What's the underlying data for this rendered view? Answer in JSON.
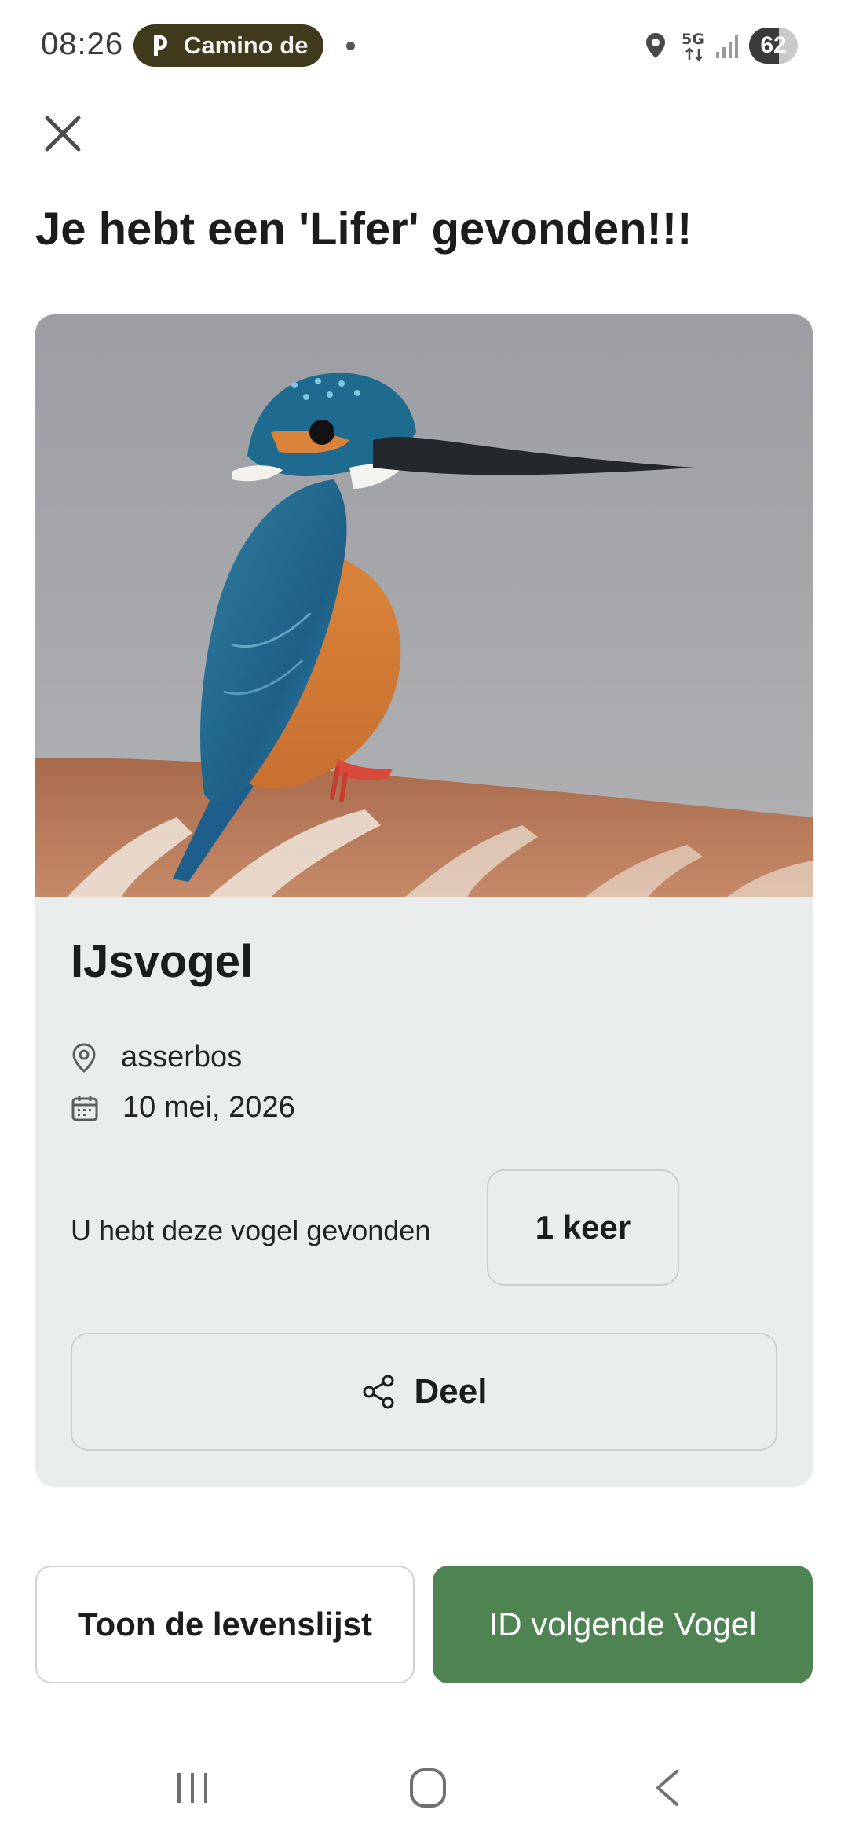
{
  "status_bar": {
    "time": "08:26",
    "app_pill": "Camino de",
    "battery": "62",
    "battery_level_pct": 62
  },
  "header": {
    "title": "Je hebt een 'Lifer' gevonden!!!"
  },
  "card": {
    "species": "IJsvogel",
    "location": "asserbos",
    "date": "10 mei, 2026",
    "found_text": "U hebt deze vogel gevonden",
    "count": "1 keer",
    "share_label": "Deel"
  },
  "actions": {
    "life_list_label": "Toon de levenslijst",
    "next_label": "ID volgende Vogel"
  },
  "colors": {
    "primary_green": "#4e8352",
    "card_bg": "#e9eeec",
    "pill_bg": "#3f3a1c"
  },
  "icons": [
    "close-icon",
    "location-pin-icon",
    "calendar-icon",
    "share-icon",
    "nav-recent-icon",
    "nav-home-icon",
    "nav-back-icon"
  ]
}
